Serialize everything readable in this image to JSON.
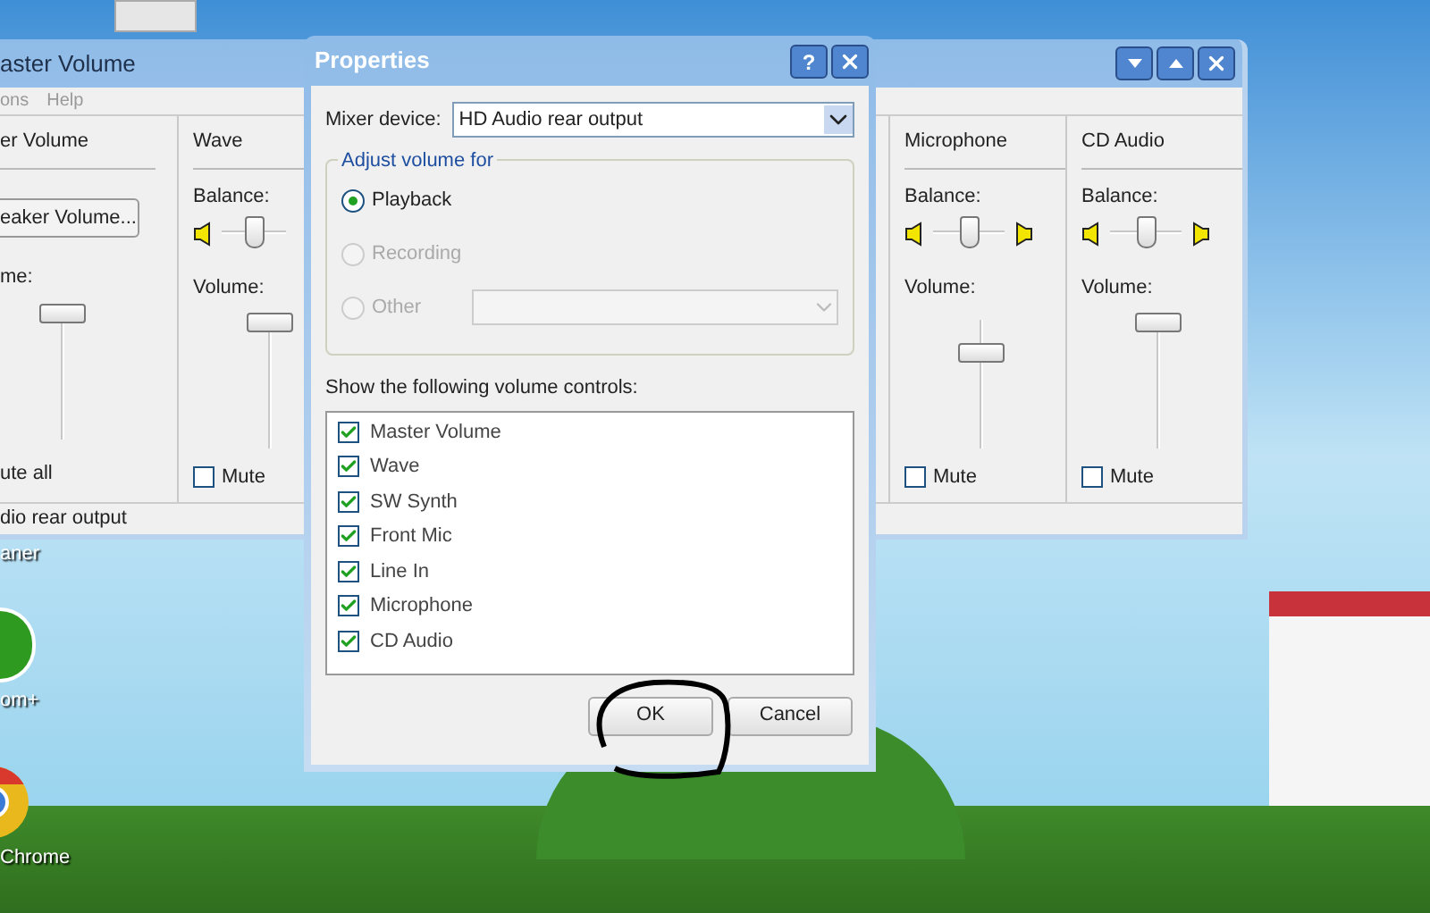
{
  "desktop": {
    "icons": [
      {
        "kind": "cleaner",
        "label": "aner"
      },
      {
        "kind": "green",
        "label": "om+"
      },
      {
        "kind": "chrome",
        "label": "Chrome"
      }
    ]
  },
  "mixer_window": {
    "title": "aster Volume",
    "menu": [
      "ons",
      "Help"
    ],
    "columns": [
      {
        "kind": "master",
        "title": "er Volume",
        "button": "eaker Volume...",
        "volume": {
          "label": "me:",
          "level": 1
        },
        "mute": {
          "label": "ute all"
        }
      },
      {
        "kind": "channel",
        "title": "Wave",
        "balance": {
          "label": "Balance:",
          "level": 0.5
        },
        "volume": {
          "label": "Volume:",
          "level": 1
        },
        "mute": {
          "label": "Mute",
          "checked": false
        }
      },
      {
        "kind": "channel",
        "title": "Microphone",
        "balance": {
          "label": "Balance:",
          "level": 0.5
        },
        "volume": {
          "label": "Volume:",
          "level": 0.75
        },
        "mute": {
          "label": "Mute",
          "checked": false
        }
      },
      {
        "kind": "channel",
        "title": "CD Audio",
        "balance": {
          "label": "Balance:",
          "level": 0.5
        },
        "volume": {
          "label": "Volume:",
          "level": 1
        },
        "mute": {
          "label": "Mute",
          "checked": false
        }
      }
    ],
    "status_bar": "dio rear output"
  },
  "dialog": {
    "title": "Properties",
    "help_button": "?",
    "mixer_device": {
      "label": "Mixer device:",
      "value": "HD Audio rear output"
    },
    "adjust_group": {
      "title": "Adjust volume for",
      "options": [
        {
          "label": "Playback",
          "selected": true,
          "disabled": false
        },
        {
          "label": "Recording",
          "selected": false,
          "disabled": true
        },
        {
          "label": "Other",
          "selected": false,
          "disabled": true
        }
      ]
    },
    "controls_label": "Show the following volume controls:",
    "controls": [
      {
        "label": "Master Volume",
        "checked": true
      },
      {
        "label": "Wave",
        "checked": true
      },
      {
        "label": "SW Synth",
        "checked": true
      },
      {
        "label": "Front Mic",
        "checked": true
      },
      {
        "label": "Line In",
        "checked": true
      },
      {
        "label": "Microphone",
        "checked": true
      },
      {
        "label": "CD Audio",
        "checked": true
      }
    ],
    "buttons": [
      "OK",
      "Cancel"
    ]
  }
}
